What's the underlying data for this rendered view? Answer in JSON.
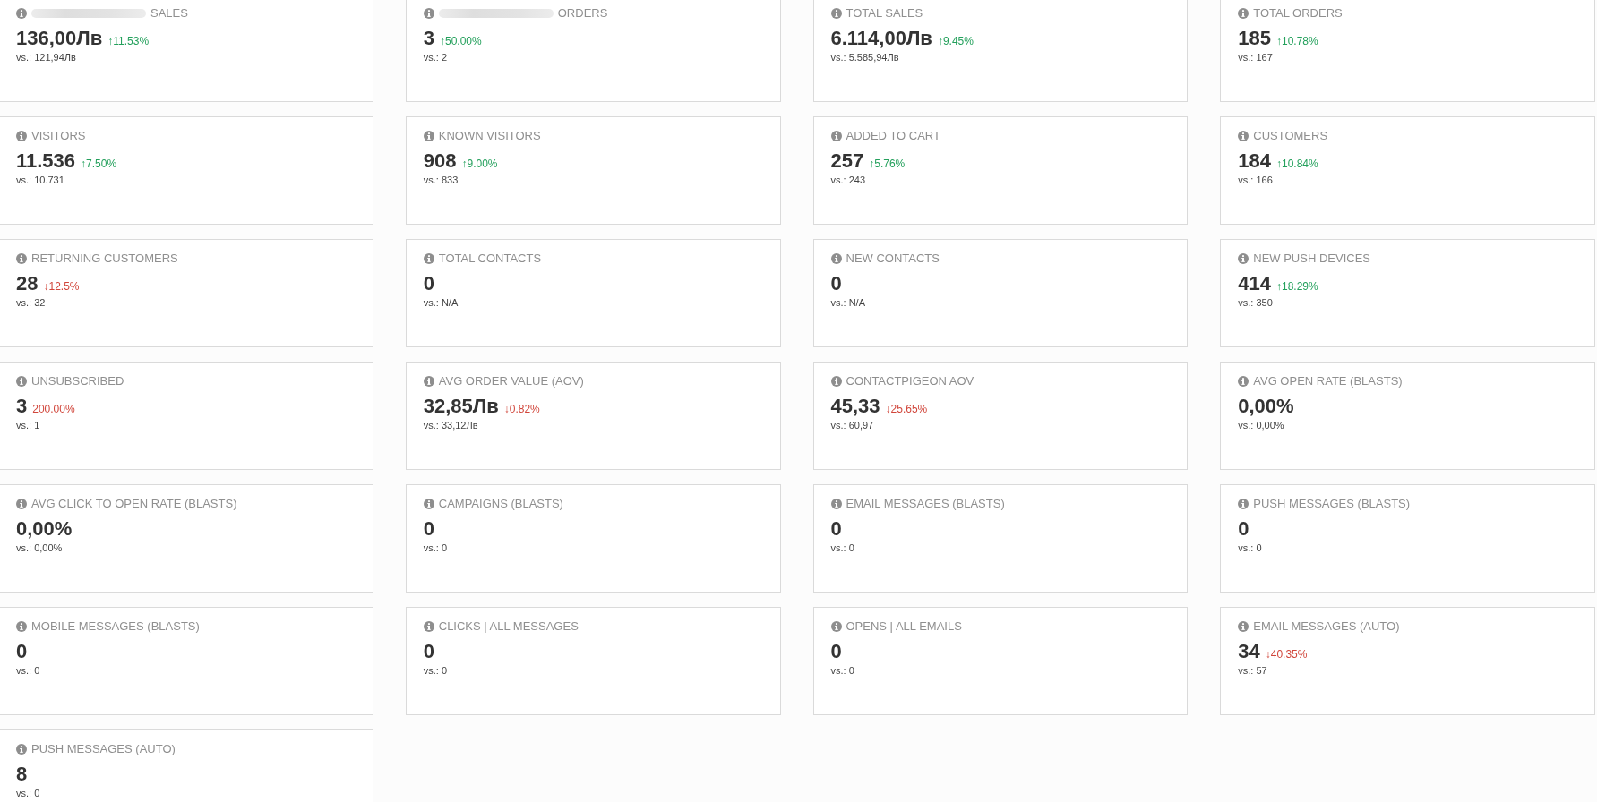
{
  "metrics": [
    {
      "label": "SALES",
      "redacted_prefix": true,
      "value": "136,00Лв",
      "change": {
        "text": "↑11.53%",
        "decrease": false
      },
      "comparison": "vs.: 121,94Лв"
    },
    {
      "label": "ORDERS",
      "redacted_prefix": true,
      "value": "3",
      "change": {
        "text": "↑50.00%",
        "decrease": false
      },
      "comparison": "vs.: 2"
    },
    {
      "label": "TOTAL SALES",
      "redacted_prefix": false,
      "value": "6.114,00Лв",
      "change": {
        "text": "↑9.45%",
        "decrease": false
      },
      "comparison": "vs.: 5.585,94Лв"
    },
    {
      "label": "TOTAL ORDERS",
      "redacted_prefix": false,
      "value": "185",
      "change": {
        "text": "↑10.78%",
        "decrease": false
      },
      "comparison": "vs.: 167"
    },
    {
      "label": "VISITORS",
      "redacted_prefix": false,
      "value": "11.536",
      "change": {
        "text": "↑7.50%",
        "decrease": false
      },
      "comparison": "vs.: 10.731"
    },
    {
      "label": "KNOWN VISITORS",
      "redacted_prefix": false,
      "value": "908",
      "change": {
        "text": "↑9.00%",
        "decrease": false
      },
      "comparison": "vs.: 833"
    },
    {
      "label": "ADDED TO CART",
      "redacted_prefix": false,
      "value": "257",
      "change": {
        "text": "↑5.76%",
        "decrease": false
      },
      "comparison": "vs.: 243"
    },
    {
      "label": "CUSTOMERS",
      "redacted_prefix": false,
      "value": "184",
      "change": {
        "text": "↑10.84%",
        "decrease": false
      },
      "comparison": "vs.: 166"
    },
    {
      "label": "RETURNING CUSTOMERS",
      "redacted_prefix": false,
      "value": "28",
      "change": {
        "text": "↓12.5%",
        "decrease": true
      },
      "comparison": "vs.: 32"
    },
    {
      "label": "TOTAL CONTACTS",
      "redacted_prefix": false,
      "value": "0",
      "comparison": "vs.: N/A"
    },
    {
      "label": "NEW CONTACTS",
      "redacted_prefix": false,
      "value": "0",
      "comparison": "vs.: N/A"
    },
    {
      "label": "NEW PUSH DEVICES",
      "redacted_prefix": false,
      "value": "414",
      "change": {
        "text": "↑18.29%",
        "decrease": false
      },
      "comparison": "vs.: 350"
    },
    {
      "label": "UNSUBSCRIBED",
      "redacted_prefix": false,
      "value": "3",
      "change": {
        "text": "200.00%",
        "decrease": true
      },
      "comparison": "vs.: 1"
    },
    {
      "label": "AVG ORDER VALUE (AOV)",
      "redacted_prefix": false,
      "value": "32,85Лв",
      "change": {
        "text": "↓0.82%",
        "decrease": true
      },
      "comparison": "vs.: 33,12Лв"
    },
    {
      "label": "CONTACTPIGEON AOV",
      "redacted_prefix": false,
      "value": "45,33",
      "change": {
        "text": "↓25.65%",
        "decrease": true
      },
      "comparison": "vs.: 60,97"
    },
    {
      "label": "AVG OPEN RATE (BLASTS)",
      "redacted_prefix": false,
      "value": "0,00%",
      "comparison": "vs.: 0,00%"
    },
    {
      "label": "AVG CLICK TO OPEN RATE (BLASTS)",
      "redacted_prefix": false,
      "value": "0,00%",
      "comparison": "vs.: 0,00%"
    },
    {
      "label": "CAMPAIGNS (BLASTS)",
      "redacted_prefix": false,
      "value": "0",
      "comparison": "vs.: 0"
    },
    {
      "label": "EMAIL MESSAGES (BLASTS)",
      "redacted_prefix": false,
      "value": "0",
      "comparison": "vs.: 0"
    },
    {
      "label": "PUSH MESSAGES (BLASTS)",
      "redacted_prefix": false,
      "value": "0",
      "comparison": "vs.: 0"
    },
    {
      "label": "MOBILE MESSAGES (BLASTS)",
      "redacted_prefix": false,
      "value": "0",
      "comparison": "vs.: 0"
    },
    {
      "label": "CLICKS | ALL MESSAGES",
      "redacted_prefix": false,
      "value": "0",
      "comparison": "vs.: 0"
    },
    {
      "label": "OPENS | ALL EMAILS",
      "redacted_prefix": false,
      "value": "0",
      "comparison": "vs.: 0"
    },
    {
      "label": "EMAIL MESSAGES (AUTO)",
      "redacted_prefix": false,
      "value": "34",
      "change": {
        "text": "↓40.35%",
        "decrease": true
      },
      "comparison": "vs.: 57"
    },
    {
      "label": "PUSH MESSAGES (AUTO)",
      "redacted_prefix": false,
      "value": "8",
      "comparison": "vs.: 0"
    }
  ]
}
